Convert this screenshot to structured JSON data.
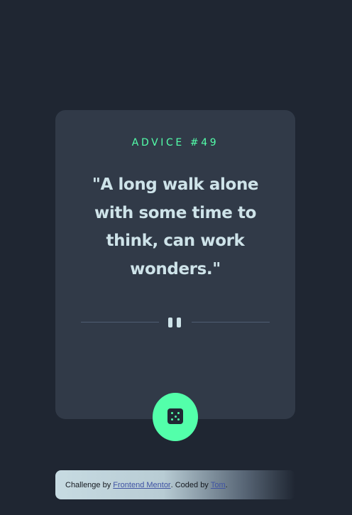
{
  "advice": {
    "id_label": "ADVICE #49",
    "quote": "\"A long walk alone with some time to think, can work wonders.\""
  },
  "icons": {
    "divider": "pause-icon",
    "generate": "dice-icon"
  },
  "attribution": {
    "prefix": "Challenge by ",
    "challenge_link": "Frontend Mentor",
    "middle": ". Coded by ",
    "author_link": "Tom",
    "suffix": "."
  },
  "colors": {
    "background": "#1f2632",
    "card": "#313a48",
    "accent": "#53ffaa",
    "text": "#cee3e9",
    "divider": "#4f5d74"
  }
}
